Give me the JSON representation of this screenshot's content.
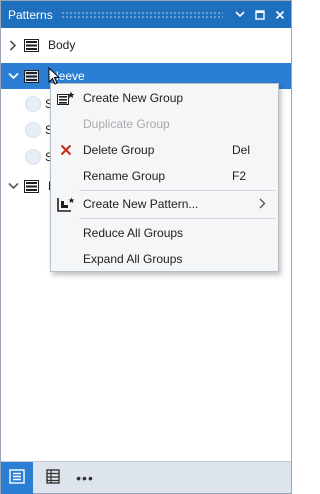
{
  "panel": {
    "title": "Patterns"
  },
  "tree": {
    "groups": [
      {
        "label": "Body",
        "expanded": false,
        "selected": false
      },
      {
        "label": "Sleeve",
        "expanded": true,
        "selected": true
      },
      {
        "label": "D",
        "expanded": true,
        "selected": false
      }
    ],
    "sleeve_children": [
      {
        "label": "S"
      },
      {
        "label": "S"
      },
      {
        "label": "S"
      }
    ]
  },
  "context_menu": {
    "items": [
      {
        "label": "Create New Group",
        "shortcut": "",
        "icon": "create-group-icon",
        "disabled": false
      },
      {
        "label": "Duplicate Group",
        "shortcut": "",
        "icon": "",
        "disabled": true
      },
      {
        "label": "Delete Group",
        "shortcut": "Del",
        "icon": "delete-x-icon",
        "disabled": false
      },
      {
        "label": "Rename Group",
        "shortcut": "F2",
        "icon": "",
        "disabled": false
      },
      {
        "label": "Create New Pattern...",
        "shortcut": "",
        "icon": "create-pattern-icon",
        "disabled": false,
        "submenu": true
      },
      {
        "label": "Reduce All Groups",
        "shortcut": "",
        "icon": "",
        "disabled": false
      },
      {
        "label": "Expand All Groups",
        "shortcut": "",
        "icon": "",
        "disabled": false
      }
    ]
  },
  "bottom_toolbar": {
    "buttons": [
      {
        "icon": "pattern-list-icon",
        "active": true
      },
      {
        "icon": "properties-icon",
        "active": false
      },
      {
        "icon": "more-icon",
        "label": "•••",
        "active": false
      }
    ]
  },
  "colors": {
    "titlebar": "#1f6fbf",
    "selection": "#2a7fd4",
    "delete_icon": "#c42b1c",
    "menu_background": "#f5f6f7"
  }
}
